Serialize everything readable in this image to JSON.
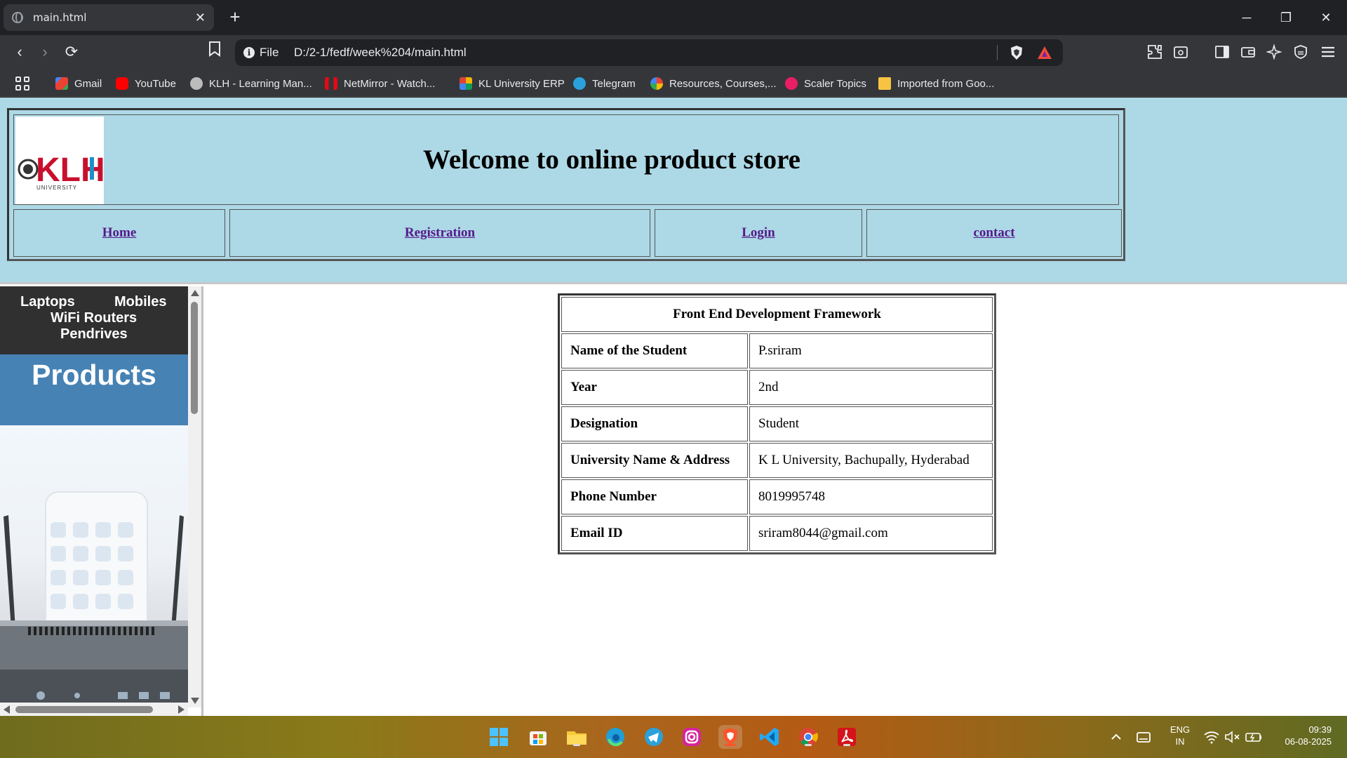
{
  "browser": {
    "tab_title": "main.html",
    "omnibox_scheme": "File",
    "omnibox_url": "D:/2-1/fedf/week%204/main.html"
  },
  "bookmarks": [
    {
      "label": "Gmail",
      "icon": "gmail-icon",
      "color": "#ea4335"
    },
    {
      "label": "YouTube",
      "icon": "youtube-icon",
      "color": "#ff0000"
    },
    {
      "label": "KLH - Learning Man...",
      "icon": "klh-icon",
      "color": "#bbbbbb"
    },
    {
      "label": "NetMirror - Watch...",
      "icon": "netmirror-icon",
      "color": "#e50914"
    },
    {
      "label": "KL University ERP",
      "icon": "erp-icon",
      "color": "#f4b400"
    },
    {
      "label": "Telegram",
      "icon": "telegram-icon",
      "color": "#2aa1da"
    },
    {
      "label": "Resources, Courses,...",
      "icon": "google-icon",
      "color": "#ffffff"
    },
    {
      "label": "Scaler Topics",
      "icon": "scaler-icon",
      "color": "#e91e63"
    },
    {
      "label": "Imported from Goo...",
      "icon": "folder-icon",
      "color": "#f6c343"
    }
  ],
  "header": {
    "title": "Welcome to online product store",
    "nav": {
      "home": "Home",
      "registration": "Registration",
      "login": "Login",
      "contact": "contact"
    },
    "logo_text": "KLH",
    "logo_sub": "UNIVERSITY"
  },
  "sidebar": {
    "laptops": "Laptops",
    "mobiles": "Mobiles",
    "wifi": "WiFi Routers",
    "pendrives": "Pendrives",
    "products": "Products"
  },
  "content": {
    "table_title": "Front End Development Framework",
    "rows": [
      {
        "label": "Name of the Student",
        "value": "P.sriram"
      },
      {
        "label": "Year",
        "value": "2nd"
      },
      {
        "label": "Designation",
        "value": "Student"
      },
      {
        "label": "University Name & Address",
        "value": "K L University, Bachupally, Hyderabad"
      },
      {
        "label": "Phone Number",
        "value": "8019995748"
      },
      {
        "label": "Email ID",
        "value": "sriram8044@gmail.com"
      }
    ]
  },
  "taskbar": {
    "lang_top": "ENG",
    "lang_bottom": "IN",
    "time": "09:39",
    "date": "06-08-2025"
  }
}
